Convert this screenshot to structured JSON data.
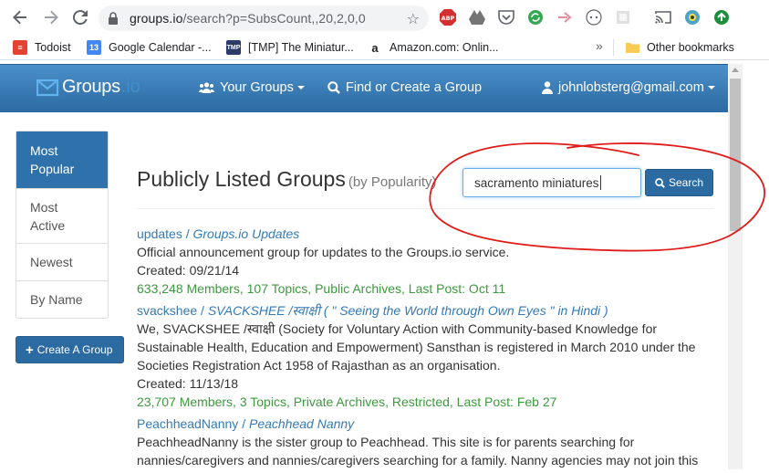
{
  "browser": {
    "url_host": "groups.io",
    "url_path": "/search?p=SubsCount,,20,2,0,0",
    "bookmarks": [
      {
        "label": "Todoist"
      },
      {
        "label": "Google Calendar -..."
      },
      {
        "label": "[TMP] The Miniatur..."
      },
      {
        "label": "Amazon.com: Onlin..."
      }
    ],
    "bookmarks_overflow": "»",
    "other_bookmarks": "Other bookmarks"
  },
  "navbar": {
    "brand_word": "Groups",
    "brand_suffix": ".io",
    "your_groups": "Your Groups",
    "find_create": "Find or Create a Group",
    "user_email": "johnlobsterg@gmail.com"
  },
  "sidebar": {
    "items": [
      {
        "label": "Most Popular"
      },
      {
        "label": "Most Active"
      },
      {
        "label": "Newest"
      },
      {
        "label": "By Name"
      }
    ],
    "create_button": "Create A Group"
  },
  "main": {
    "title": "Publicly Listed Groups",
    "subtitle": "(by Popularity)",
    "search_value": "sacramento miniatures",
    "search_button": "Search"
  },
  "results": [
    {
      "name": "updates",
      "full_name": "Groups.io Updates",
      "description": "Official announcement group for updates to the Groups.io service.",
      "created": "Created: 09/21/14",
      "stats": "633,248 Members, 107 Topics, Public Archives, Last Post: Oct 11"
    },
    {
      "name": "svackshee",
      "full_name": "SVACKSHEE /स्वाक्षी ( \" Seeing the World through Own Eyes \" in Hindi )",
      "description": "We, SVACKSHEE /स्वाक्षी (Society for Voluntary Action with Community-based Knowledge for Sustainable Health, Education and Empowerment) Sansthan is registered in March 2010 under the Societies Registration Act 1958 of Rajasthan as an organisation.",
      "created": "Created: 11/13/18",
      "stats": "23,707 Members, 3 Topics, Private Archives, Restricted, Last Post: Feb 27"
    },
    {
      "name": "PeachheadNanny",
      "full_name": "Peachhead Nanny",
      "description": "PeachheadNanny is the sister group to Peachhead. This site is for parents searching for nannies/caregivers and nannies/caregivers searching for a family. Nanny agencies may not join this",
      "created": "",
      "stats": ""
    }
  ],
  "colors": {
    "navbar": "#2c6aa2",
    "link": "#337ab7",
    "stats": "#3c9a3c",
    "annotation": "#e01b1b"
  }
}
